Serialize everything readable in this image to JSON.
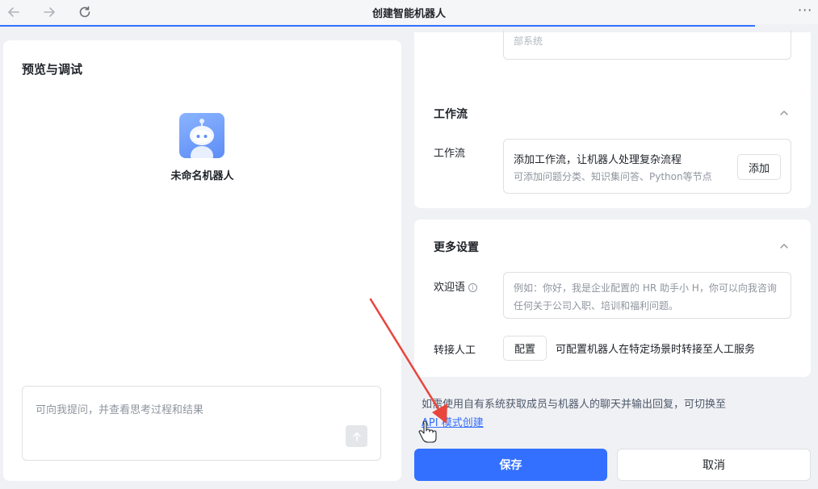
{
  "window": {
    "title": "创建智能机器人",
    "more_label": "···"
  },
  "preview": {
    "title": "预览与调试",
    "bot_name": "未命名机器人",
    "chat_placeholder": "可向我提问，并查看思考过程和结果"
  },
  "top_card": {
    "partial_text": "部系统"
  },
  "workflow": {
    "section_title": "工作流",
    "field_label": "工作流",
    "main_text": "添加工作流，让机器人处理复杂流程",
    "sub_text": "可添加问题分类、知识集问答、Python等节点",
    "add_label": "添加"
  },
  "settings": {
    "section_title": "更多设置",
    "welcome_label": "欢迎语",
    "welcome_placeholder": "例如：你好，我是企业配置的 HR 助手小 H，你可以向我咨询任何关于公司入职、培训和福利问题。",
    "transfer_label": "转接人工",
    "configure_label": "配置",
    "transfer_desc": "可配置机器人在特定场景时转接至人工服务"
  },
  "footer": {
    "api_note": "如需使用自有系统获取成员与机器人的聊天并输出回复，可切换至",
    "api_link": "API 模式创建",
    "save_label": "保存",
    "cancel_label": "取消"
  },
  "colors": {
    "primary": "#3370ff",
    "annotation_arrow": "#e8453c"
  }
}
